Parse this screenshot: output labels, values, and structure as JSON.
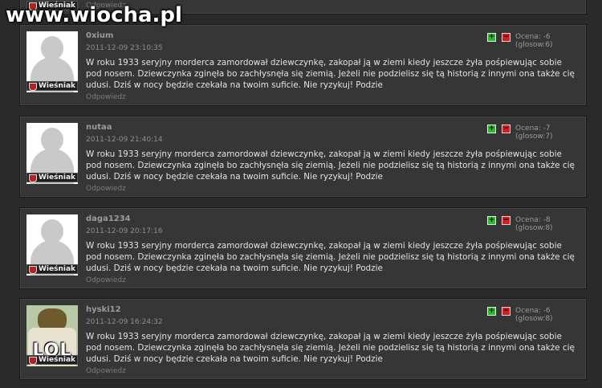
{
  "site": {
    "watermark": "www.wiocha.pl"
  },
  "top_item": {
    "rank": "Wieśniak",
    "reply": "Odpowiedz"
  },
  "comments": [
    {
      "author": "0xium",
      "date": "2011-12-09 23:10:35",
      "rating": "Ocena: -6 (glosow:6)",
      "rank": "Wieśniak",
      "text": "W roku 1933 seryjny morderca zamordował dziewczynkę, zakopał ją w ziemi kiedy jeszcze żyła pośpiewując sobie pod nosem. Dziewczynka zginęła bo zachłysnęła się ziemią. Jeżeli nie podzielisz się tą historią z innymi ona także cię udusi. Dziś w nocy będzie czekała na twoim suficie. Nie ryzykuj! Podzie",
      "reply": "Odpowiedz"
    },
    {
      "author": "nutaa",
      "date": "2011-12-09 21:40:14",
      "rating": "Ocena: -7 (glosow:7)",
      "rank": "Wieśniak",
      "text": "W roku 1933 seryjny morderca zamordował dziewczynkę, zakopał ją w ziemi kiedy jeszcze żyła pośpiewując sobie pod nosem. Dziewczynka zginęła bo zachłysnęła się ziemią. Jeżeli nie podzielisz się tą historią z innymi ona także cię udusi. Dziś w nocy będzie czekała na twoim suficie. Nie ryzykuj! Podzie",
      "reply": "Odpowiedz"
    },
    {
      "author": "daga1234",
      "date": "2011-12-09 20:17:16",
      "rating": "Ocena: -8 (glosow:8)",
      "rank": "Wieśniak",
      "text": "W roku 1933 seryjny morderca zamordował dziewczynkę, zakopał ją w ziemi kiedy jeszcze żyła pośpiewując sobie pod nosem. Dziewczynka zginęła bo zachłysnęła się ziemią. Jeżeli nie podzielisz się tą historią z innymi ona także cię udusi. Dziś w nocy będzie czekała na twoim suficie. Nie ryzykuj! Podzie",
      "reply": "Odpowiedz"
    },
    {
      "author": "hyski12",
      "date": "2011-12-09 16:24:32",
      "rating": "Ocena: -6 (glosow:8)",
      "rank": "Wieśniak",
      "avatar_caption": "LOL",
      "text": "W roku 1933 seryjny morderca zamordował dziewczynkę, zakopał ją w ziemi kiedy jeszcze żyła pośpiewując sobie pod nosem. Dziewczynka zginęła bo zachłysnęła się ziemią. Jeżeli nie podzielisz się tą historią z innymi ona także cię udusi. Dziś w nocy będzie czekała na twoim suficie. Nie ryzykuj! Podzie",
      "reply": "Odpowiedz"
    }
  ],
  "vote": {
    "plus": "+",
    "minus": "−"
  },
  "colors": {
    "background": "#2a2a2a",
    "panel": "#363636",
    "plus": "#2fb82f",
    "minus": "#d21f1f",
    "rank_shield": "#b22222"
  }
}
